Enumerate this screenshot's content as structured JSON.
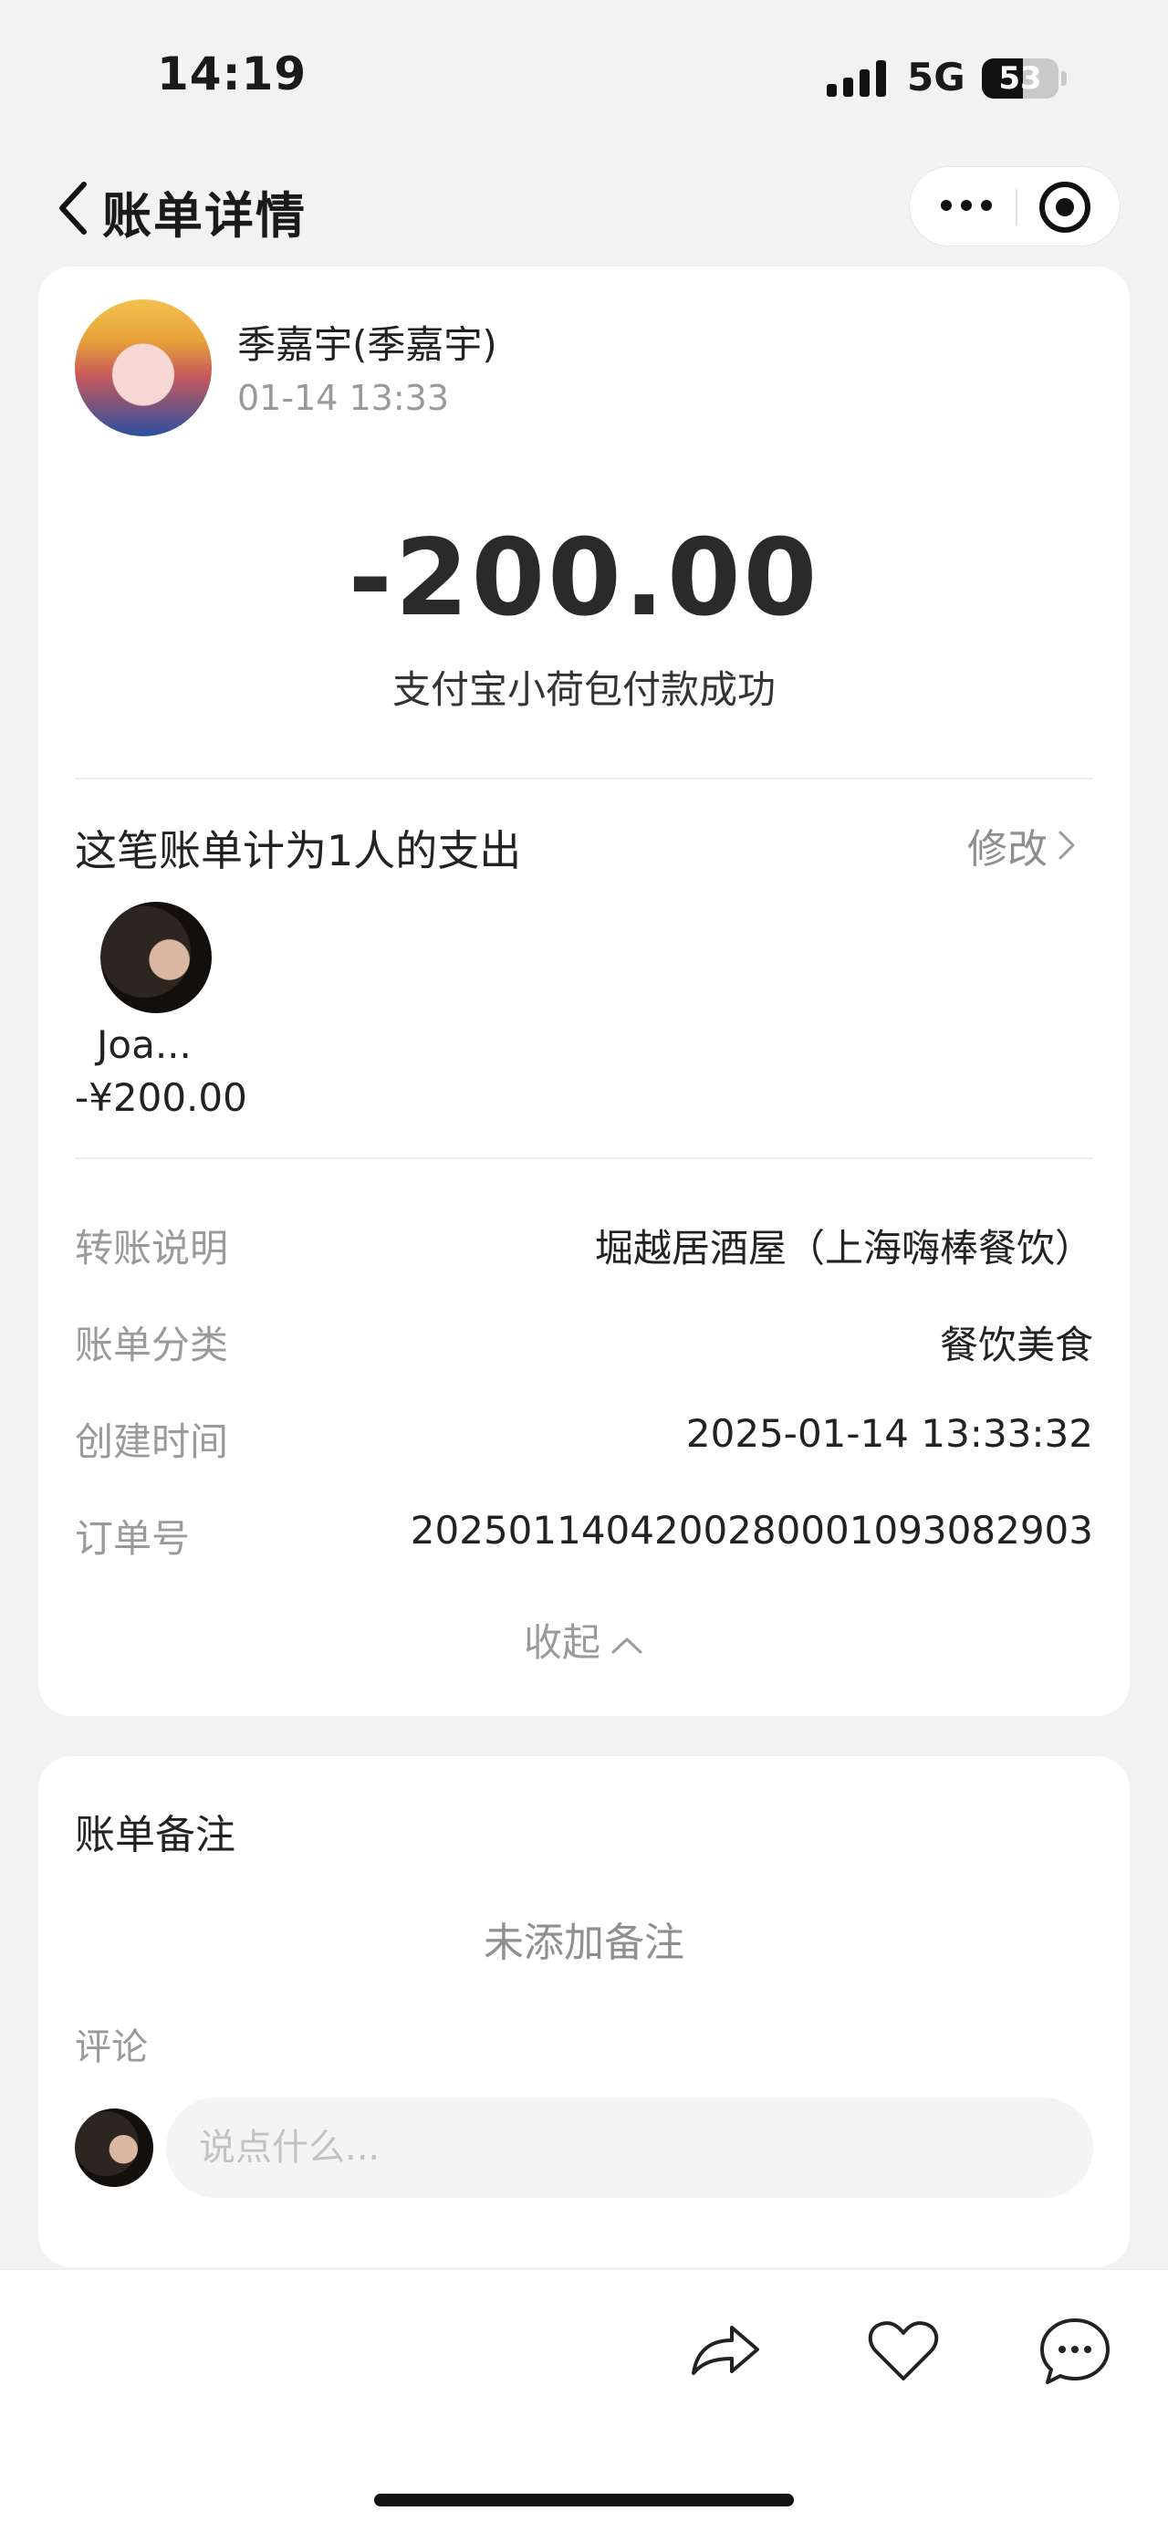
{
  "status_bar": {
    "time": "14:19",
    "network": "5G",
    "battery": "53"
  },
  "header": {
    "title": "账单详情",
    "more_icon": "more-dots-icon",
    "target_icon": "target-icon"
  },
  "bill": {
    "payer_name": "季嘉宇(季嘉宇)",
    "time": "01-14 13:33",
    "amount": "-200.00",
    "status": "支付宝小荷包付款成功"
  },
  "split": {
    "title": "这笔账单计为1人的支出",
    "edit_label": "修改",
    "members": [
      {
        "name": "Joa...",
        "amount": "-¥200.00"
      }
    ]
  },
  "details": [
    {
      "label": "转账说明",
      "value": "堀越居酒屋（上海嗨棒餐饮）"
    },
    {
      "label": "账单分类",
      "value": "餐饮美食"
    },
    {
      "label": "创建时间",
      "value": "2025-01-14 13:33:32"
    },
    {
      "label": "订单号",
      "value": "2025011404200280001093082903"
    }
  ],
  "collapse_label": "收起",
  "notes": {
    "title": "账单备注",
    "empty_text": "未添加备注",
    "comment_label": "评论",
    "comment_placeholder": "说点什么..."
  },
  "actions": {
    "share_icon": "share-icon",
    "like_icon": "heart-icon",
    "comment_icon": "comment-icon"
  }
}
